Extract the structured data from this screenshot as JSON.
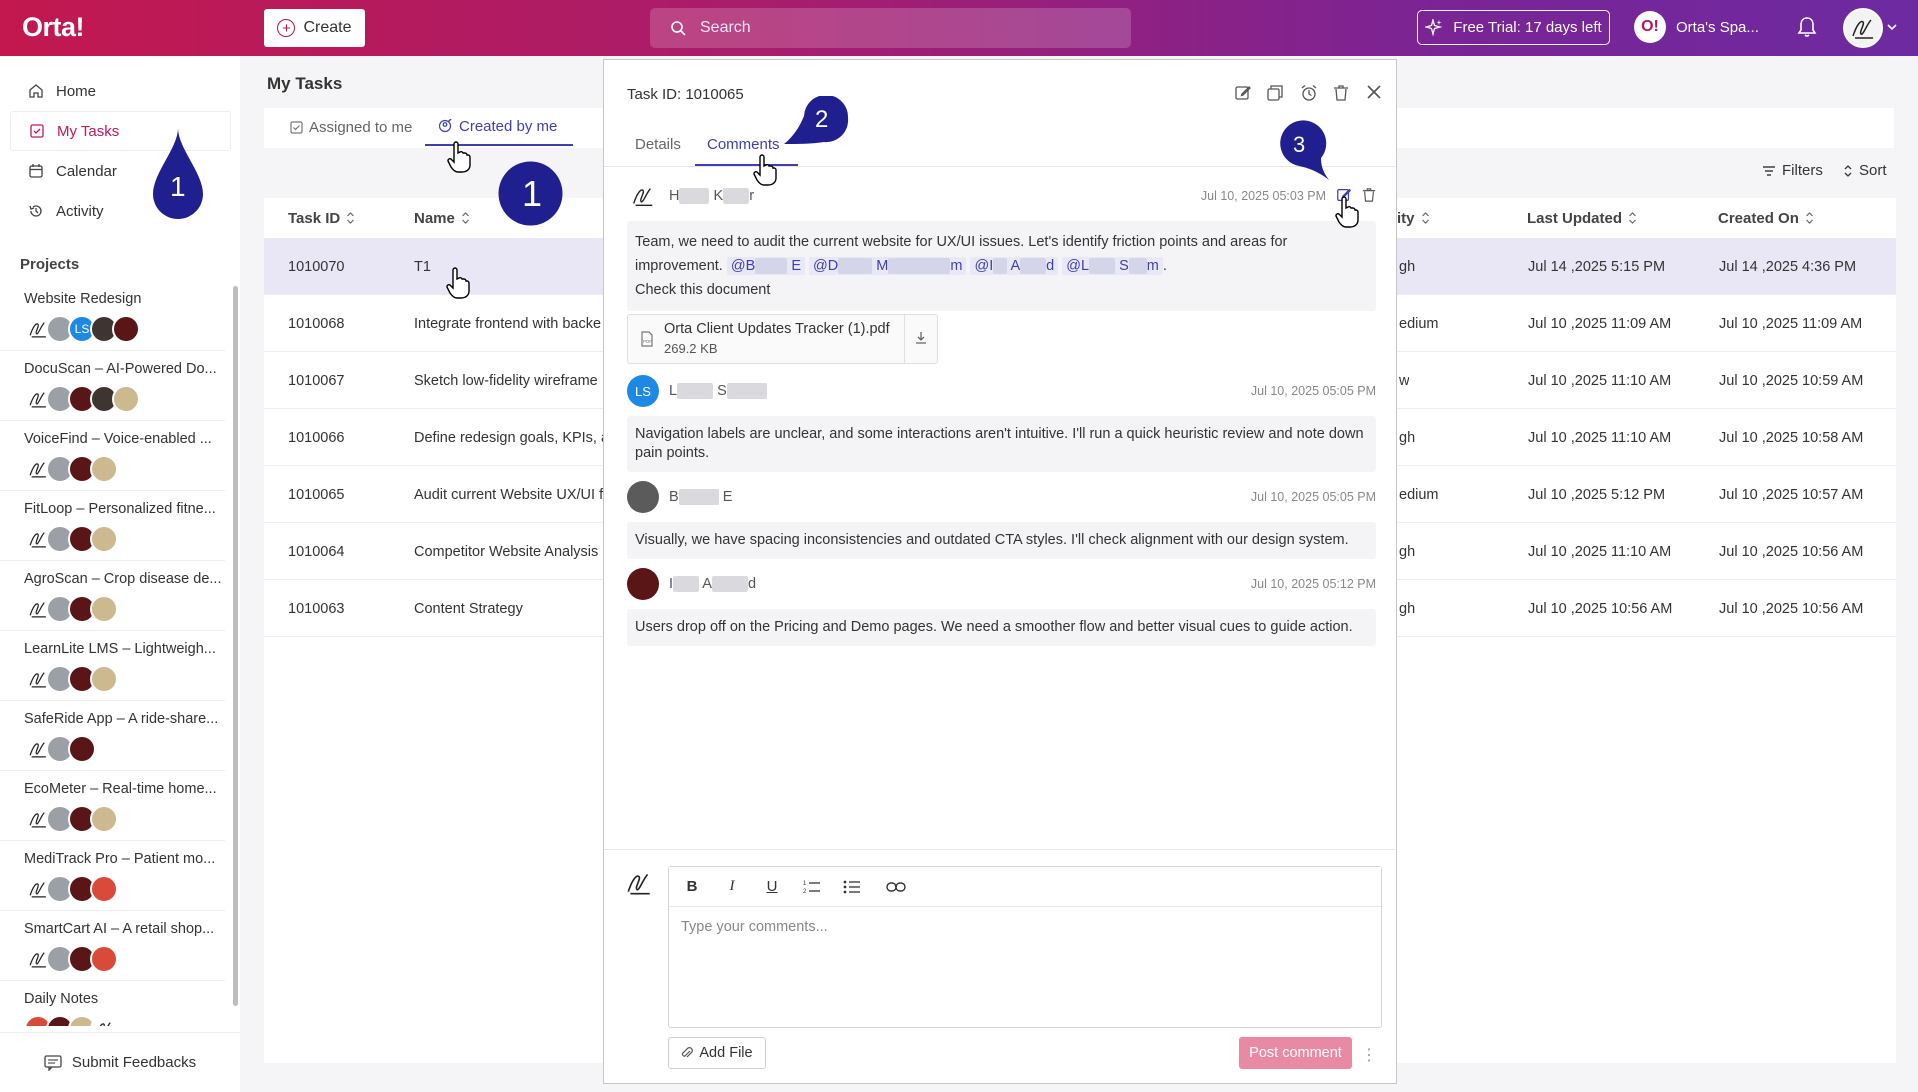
{
  "app": {
    "logo": "Orta!",
    "create_label": "Create",
    "search_placeholder": "Search",
    "trial_label": "Free Trial: 17 days left",
    "workspace_logo": "O!",
    "workspace_name": "Orta's Spa..."
  },
  "sidebar": {
    "nav": [
      {
        "label": "Home",
        "icon": "home-icon"
      },
      {
        "label": "My Tasks",
        "icon": "checkbox-icon"
      },
      {
        "label": "Calendar",
        "icon": "calendar-icon"
      },
      {
        "label": "Activity",
        "icon": "history-icon"
      }
    ],
    "projects_title": "Projects",
    "projects": [
      {
        "name": "Website Redesign",
        "avatars": [
          "sig",
          "gray",
          "blue:LS",
          "dark",
          "maroon"
        ]
      },
      {
        "name": "DocuScan – AI-Powered Do...",
        "avatars": [
          "sig",
          "gray",
          "maroon",
          "dark",
          "beige"
        ]
      },
      {
        "name": "VoiceFind – Voice-enabled ...",
        "avatars": [
          "sig",
          "gray",
          "maroon",
          "beige"
        ]
      },
      {
        "name": "FitLoop – Personalized fitne...",
        "avatars": [
          "sig",
          "gray",
          "maroon",
          "beige"
        ]
      },
      {
        "name": "AgroScan – Crop disease de...",
        "avatars": [
          "sig",
          "gray",
          "maroon",
          "beige"
        ]
      },
      {
        "name": "LearnLite LMS – Lightweigh...",
        "avatars": [
          "sig",
          "gray",
          "maroon",
          "beige"
        ]
      },
      {
        "name": "SafeRide App – A ride-share...",
        "avatars": [
          "sig",
          "gray",
          "maroon"
        ]
      },
      {
        "name": "EcoMeter – Real-time home...",
        "avatars": [
          "sig",
          "gray",
          "maroon",
          "beige"
        ]
      },
      {
        "name": "MediTrack Pro – Patient mo...",
        "avatars": [
          "sig",
          "gray",
          "maroon",
          "red"
        ]
      },
      {
        "name": "SmartCart AI – A retail shop...",
        "avatars": [
          "sig",
          "gray",
          "maroon",
          "red"
        ]
      },
      {
        "name": "Daily Notes",
        "avatars": [
          "red",
          "maroon",
          "beige",
          "sig"
        ]
      }
    ],
    "submit_feedback": "Submit Feedbacks"
  },
  "main": {
    "title": "My Tasks",
    "tabs": [
      {
        "label": "Assigned to me"
      },
      {
        "label": "Created by me"
      }
    ],
    "filters_label": "Filters",
    "sort_label": "Sort",
    "columns": {
      "task_id": "Task ID",
      "name": "Name",
      "priority": "ity",
      "last_updated": "Last Updated",
      "created_on": "Created On"
    },
    "rows": [
      {
        "id": "1010070",
        "name": "T1",
        "priority": "gh",
        "updated": "Jul 14 ,2025 5:15 PM",
        "created": "Jul 14 ,2025 4:36 PM"
      },
      {
        "id": "1010068",
        "name": "Integrate frontend with backe",
        "priority": "edium",
        "updated": "Jul 10 ,2025 11:09 AM",
        "created": "Jul 10 ,2025 11:09 AM"
      },
      {
        "id": "1010067",
        "name": "Sketch low-fidelity wireframe",
        "priority": "w",
        "updated": "Jul 10 ,2025 11:10 AM",
        "created": "Jul 10 ,2025 10:59 AM"
      },
      {
        "id": "1010066",
        "name": "Define redesign goals, KPIs, a",
        "priority": "gh",
        "updated": "Jul 10 ,2025 11:10 AM",
        "created": "Jul 10 ,2025 10:58 AM"
      },
      {
        "id": "1010065",
        "name": "Audit current Website UX/UI f",
        "priority": "edium",
        "updated": "Jul 10 ,2025 5:12 PM",
        "created": "Jul 10 ,2025 10:57 AM"
      },
      {
        "id": "1010064",
        "name": "Competitor Website Analysis",
        "priority": "gh",
        "updated": "Jul 10 ,2025 11:10 AM",
        "created": "Jul 10 ,2025 10:56 AM"
      },
      {
        "id": "1010063",
        "name": "Content Strategy",
        "priority": "gh",
        "updated": "Jul 10 ,2025 10:56 AM",
        "created": "Jul 10 ,2025 10:56 AM"
      }
    ]
  },
  "panel": {
    "task_id_label": "Task ID:  1010065",
    "tabs": [
      {
        "label": "Details"
      },
      {
        "label": "Comments"
      }
    ],
    "comments": [
      {
        "author_a": "H",
        "author_b": "K",
        "author_c": "r",
        "time": "Jul 10, 2025 05:03 PM",
        "text_1": "Team, we need to audit the current website for UX/UI issues. Let's identify friction points and areas for",
        "text_2": "improvement.",
        "mentions": [
          "@B",
          "E",
          "@D",
          "M",
          "m",
          "@I",
          "A",
          "d",
          "@L",
          "S",
          "m"
        ],
        "text_3": "Check this document"
      },
      {
        "author_initials": "LS",
        "author_a": "L",
        "author_b": "S",
        "time": "Jul 10, 2025 05:05 PM",
        "text": "Navigation labels are unclear, and some interactions aren't intuitive. I'll run a quick heuristic review and note down pain points."
      },
      {
        "author_a": "B",
        "author_b": "E",
        "time": "Jul 10, 2025 05:05 PM",
        "text": "Visually, we have spacing inconsistencies and outdated CTA styles. I'll check alignment with our design system."
      },
      {
        "author_a": "I",
        "author_b": "A",
        "author_c": "d",
        "time": "Jul 10, 2025 05:12 PM",
        "text": "Users drop off on the Pricing and Demo pages. We need a smoother flow and better visual cues to guide action."
      }
    ],
    "attachment": {
      "name": "Orta Client Updates Tracker (1).pdf",
      "size": "269.2 KB"
    },
    "editor_placeholder": "Type your comments...",
    "add_file_label": "Add File",
    "post_label": "Post comment",
    "more_label": "⋮"
  },
  "markers": {
    "m1": "1",
    "m1b": "1",
    "m2": "2",
    "m3": "3"
  },
  "colors": {
    "brand": "#c2184f",
    "accent": "#3f3fb0",
    "marker": "#1f1f8f",
    "post_button": "#e98aa5"
  }
}
